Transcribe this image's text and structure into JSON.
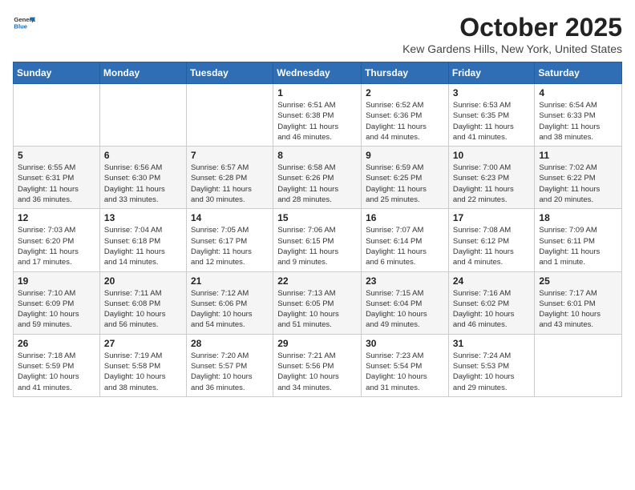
{
  "header": {
    "logo": {
      "general": "General",
      "blue": "Blue"
    },
    "title": "October 2025",
    "location": "Kew Gardens Hills, New York, United States"
  },
  "weekdays": [
    "Sunday",
    "Monday",
    "Tuesday",
    "Wednesday",
    "Thursday",
    "Friday",
    "Saturday"
  ],
  "weeks": [
    [
      {
        "day": "",
        "info": ""
      },
      {
        "day": "",
        "info": ""
      },
      {
        "day": "",
        "info": ""
      },
      {
        "day": "1",
        "info": "Sunrise: 6:51 AM\nSunset: 6:38 PM\nDaylight: 11 hours\nand 46 minutes."
      },
      {
        "day": "2",
        "info": "Sunrise: 6:52 AM\nSunset: 6:36 PM\nDaylight: 11 hours\nand 44 minutes."
      },
      {
        "day": "3",
        "info": "Sunrise: 6:53 AM\nSunset: 6:35 PM\nDaylight: 11 hours\nand 41 minutes."
      },
      {
        "day": "4",
        "info": "Sunrise: 6:54 AM\nSunset: 6:33 PM\nDaylight: 11 hours\nand 38 minutes."
      }
    ],
    [
      {
        "day": "5",
        "info": "Sunrise: 6:55 AM\nSunset: 6:31 PM\nDaylight: 11 hours\nand 36 minutes."
      },
      {
        "day": "6",
        "info": "Sunrise: 6:56 AM\nSunset: 6:30 PM\nDaylight: 11 hours\nand 33 minutes."
      },
      {
        "day": "7",
        "info": "Sunrise: 6:57 AM\nSunset: 6:28 PM\nDaylight: 11 hours\nand 30 minutes."
      },
      {
        "day": "8",
        "info": "Sunrise: 6:58 AM\nSunset: 6:26 PM\nDaylight: 11 hours\nand 28 minutes."
      },
      {
        "day": "9",
        "info": "Sunrise: 6:59 AM\nSunset: 6:25 PM\nDaylight: 11 hours\nand 25 minutes."
      },
      {
        "day": "10",
        "info": "Sunrise: 7:00 AM\nSunset: 6:23 PM\nDaylight: 11 hours\nand 22 minutes."
      },
      {
        "day": "11",
        "info": "Sunrise: 7:02 AM\nSunset: 6:22 PM\nDaylight: 11 hours\nand 20 minutes."
      }
    ],
    [
      {
        "day": "12",
        "info": "Sunrise: 7:03 AM\nSunset: 6:20 PM\nDaylight: 11 hours\nand 17 minutes."
      },
      {
        "day": "13",
        "info": "Sunrise: 7:04 AM\nSunset: 6:18 PM\nDaylight: 11 hours\nand 14 minutes."
      },
      {
        "day": "14",
        "info": "Sunrise: 7:05 AM\nSunset: 6:17 PM\nDaylight: 11 hours\nand 12 minutes."
      },
      {
        "day": "15",
        "info": "Sunrise: 7:06 AM\nSunset: 6:15 PM\nDaylight: 11 hours\nand 9 minutes."
      },
      {
        "day": "16",
        "info": "Sunrise: 7:07 AM\nSunset: 6:14 PM\nDaylight: 11 hours\nand 6 minutes."
      },
      {
        "day": "17",
        "info": "Sunrise: 7:08 AM\nSunset: 6:12 PM\nDaylight: 11 hours\nand 4 minutes."
      },
      {
        "day": "18",
        "info": "Sunrise: 7:09 AM\nSunset: 6:11 PM\nDaylight: 11 hours\nand 1 minute."
      }
    ],
    [
      {
        "day": "19",
        "info": "Sunrise: 7:10 AM\nSunset: 6:09 PM\nDaylight: 10 hours\nand 59 minutes."
      },
      {
        "day": "20",
        "info": "Sunrise: 7:11 AM\nSunset: 6:08 PM\nDaylight: 10 hours\nand 56 minutes."
      },
      {
        "day": "21",
        "info": "Sunrise: 7:12 AM\nSunset: 6:06 PM\nDaylight: 10 hours\nand 54 minutes."
      },
      {
        "day": "22",
        "info": "Sunrise: 7:13 AM\nSunset: 6:05 PM\nDaylight: 10 hours\nand 51 minutes."
      },
      {
        "day": "23",
        "info": "Sunrise: 7:15 AM\nSunset: 6:04 PM\nDaylight: 10 hours\nand 49 minutes."
      },
      {
        "day": "24",
        "info": "Sunrise: 7:16 AM\nSunset: 6:02 PM\nDaylight: 10 hours\nand 46 minutes."
      },
      {
        "day": "25",
        "info": "Sunrise: 7:17 AM\nSunset: 6:01 PM\nDaylight: 10 hours\nand 43 minutes."
      }
    ],
    [
      {
        "day": "26",
        "info": "Sunrise: 7:18 AM\nSunset: 5:59 PM\nDaylight: 10 hours\nand 41 minutes."
      },
      {
        "day": "27",
        "info": "Sunrise: 7:19 AM\nSunset: 5:58 PM\nDaylight: 10 hours\nand 38 minutes."
      },
      {
        "day": "28",
        "info": "Sunrise: 7:20 AM\nSunset: 5:57 PM\nDaylight: 10 hours\nand 36 minutes."
      },
      {
        "day": "29",
        "info": "Sunrise: 7:21 AM\nSunset: 5:56 PM\nDaylight: 10 hours\nand 34 minutes."
      },
      {
        "day": "30",
        "info": "Sunrise: 7:23 AM\nSunset: 5:54 PM\nDaylight: 10 hours\nand 31 minutes."
      },
      {
        "day": "31",
        "info": "Sunrise: 7:24 AM\nSunset: 5:53 PM\nDaylight: 10 hours\nand 29 minutes."
      },
      {
        "day": "",
        "info": ""
      }
    ]
  ]
}
